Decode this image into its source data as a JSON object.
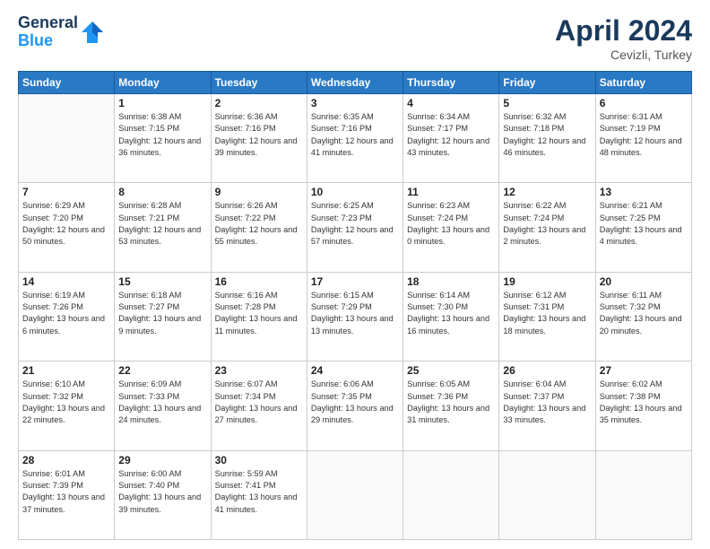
{
  "header": {
    "logo_line1": "General",
    "logo_line2": "Blue",
    "month_title": "April 2024",
    "location": "Cevizli, Turkey"
  },
  "weekdays": [
    "Sunday",
    "Monday",
    "Tuesday",
    "Wednesday",
    "Thursday",
    "Friday",
    "Saturday"
  ],
  "weeks": [
    [
      {
        "day": "",
        "detail": ""
      },
      {
        "day": "1",
        "detail": "Sunrise: 6:38 AM\nSunset: 7:15 PM\nDaylight: 12 hours\nand 36 minutes."
      },
      {
        "day": "2",
        "detail": "Sunrise: 6:36 AM\nSunset: 7:16 PM\nDaylight: 12 hours\nand 39 minutes."
      },
      {
        "day": "3",
        "detail": "Sunrise: 6:35 AM\nSunset: 7:16 PM\nDaylight: 12 hours\nand 41 minutes."
      },
      {
        "day": "4",
        "detail": "Sunrise: 6:34 AM\nSunset: 7:17 PM\nDaylight: 12 hours\nand 43 minutes."
      },
      {
        "day": "5",
        "detail": "Sunrise: 6:32 AM\nSunset: 7:18 PM\nDaylight: 12 hours\nand 46 minutes."
      },
      {
        "day": "6",
        "detail": "Sunrise: 6:31 AM\nSunset: 7:19 PM\nDaylight: 12 hours\nand 48 minutes."
      }
    ],
    [
      {
        "day": "7",
        "detail": "Sunrise: 6:29 AM\nSunset: 7:20 PM\nDaylight: 12 hours\nand 50 minutes."
      },
      {
        "day": "8",
        "detail": "Sunrise: 6:28 AM\nSunset: 7:21 PM\nDaylight: 12 hours\nand 53 minutes."
      },
      {
        "day": "9",
        "detail": "Sunrise: 6:26 AM\nSunset: 7:22 PM\nDaylight: 12 hours\nand 55 minutes."
      },
      {
        "day": "10",
        "detail": "Sunrise: 6:25 AM\nSunset: 7:23 PM\nDaylight: 12 hours\nand 57 minutes."
      },
      {
        "day": "11",
        "detail": "Sunrise: 6:23 AM\nSunset: 7:24 PM\nDaylight: 13 hours\nand 0 minutes."
      },
      {
        "day": "12",
        "detail": "Sunrise: 6:22 AM\nSunset: 7:24 PM\nDaylight: 13 hours\nand 2 minutes."
      },
      {
        "day": "13",
        "detail": "Sunrise: 6:21 AM\nSunset: 7:25 PM\nDaylight: 13 hours\nand 4 minutes."
      }
    ],
    [
      {
        "day": "14",
        "detail": "Sunrise: 6:19 AM\nSunset: 7:26 PM\nDaylight: 13 hours\nand 6 minutes."
      },
      {
        "day": "15",
        "detail": "Sunrise: 6:18 AM\nSunset: 7:27 PM\nDaylight: 13 hours\nand 9 minutes."
      },
      {
        "day": "16",
        "detail": "Sunrise: 6:16 AM\nSunset: 7:28 PM\nDaylight: 13 hours\nand 11 minutes."
      },
      {
        "day": "17",
        "detail": "Sunrise: 6:15 AM\nSunset: 7:29 PM\nDaylight: 13 hours\nand 13 minutes."
      },
      {
        "day": "18",
        "detail": "Sunrise: 6:14 AM\nSunset: 7:30 PM\nDaylight: 13 hours\nand 16 minutes."
      },
      {
        "day": "19",
        "detail": "Sunrise: 6:12 AM\nSunset: 7:31 PM\nDaylight: 13 hours\nand 18 minutes."
      },
      {
        "day": "20",
        "detail": "Sunrise: 6:11 AM\nSunset: 7:32 PM\nDaylight: 13 hours\nand 20 minutes."
      }
    ],
    [
      {
        "day": "21",
        "detail": "Sunrise: 6:10 AM\nSunset: 7:32 PM\nDaylight: 13 hours\nand 22 minutes."
      },
      {
        "day": "22",
        "detail": "Sunrise: 6:09 AM\nSunset: 7:33 PM\nDaylight: 13 hours\nand 24 minutes."
      },
      {
        "day": "23",
        "detail": "Sunrise: 6:07 AM\nSunset: 7:34 PM\nDaylight: 13 hours\nand 27 minutes."
      },
      {
        "day": "24",
        "detail": "Sunrise: 6:06 AM\nSunset: 7:35 PM\nDaylight: 13 hours\nand 29 minutes."
      },
      {
        "day": "25",
        "detail": "Sunrise: 6:05 AM\nSunset: 7:36 PM\nDaylight: 13 hours\nand 31 minutes."
      },
      {
        "day": "26",
        "detail": "Sunrise: 6:04 AM\nSunset: 7:37 PM\nDaylight: 13 hours\nand 33 minutes."
      },
      {
        "day": "27",
        "detail": "Sunrise: 6:02 AM\nSunset: 7:38 PM\nDaylight: 13 hours\nand 35 minutes."
      }
    ],
    [
      {
        "day": "28",
        "detail": "Sunrise: 6:01 AM\nSunset: 7:39 PM\nDaylight: 13 hours\nand 37 minutes."
      },
      {
        "day": "29",
        "detail": "Sunrise: 6:00 AM\nSunset: 7:40 PM\nDaylight: 13 hours\nand 39 minutes."
      },
      {
        "day": "30",
        "detail": "Sunrise: 5:59 AM\nSunset: 7:41 PM\nDaylight: 13 hours\nand 41 minutes."
      },
      {
        "day": "",
        "detail": ""
      },
      {
        "day": "",
        "detail": ""
      },
      {
        "day": "",
        "detail": ""
      },
      {
        "day": "",
        "detail": ""
      }
    ]
  ]
}
